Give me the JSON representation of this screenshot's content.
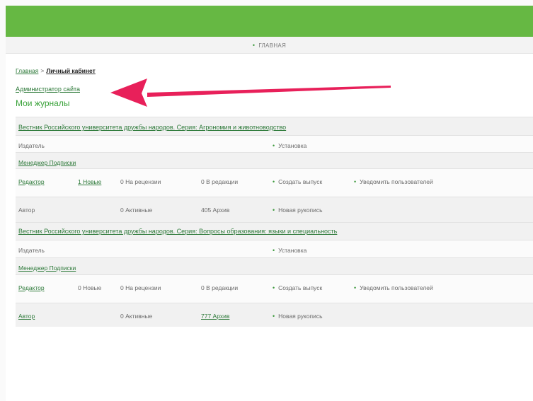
{
  "menu": {
    "home": "ГЛАВНАЯ"
  },
  "breadcrumb": {
    "home": "Главная",
    "separator": ">",
    "current": "Личный кабинет"
  },
  "role_link": "Администратор сайта",
  "page_title": "Мои журналы",
  "bullet": "•",
  "annotation_color": "#e8205a",
  "journals": [
    {
      "title": "Вестник Российского университета дружбы народов. Серия: Агрономия и животноводство",
      "publisher": {
        "label": "Издатель",
        "action": "Установка"
      },
      "subscription_manager": "Менеджер Подписки",
      "editor": {
        "label": "Редактор",
        "new": "1 Новые",
        "review": "0 На рецензии",
        "editing": "0 В редакции",
        "action1": "Создать выпуск",
        "action2": "Уведомить пользователей"
      },
      "author": {
        "label": "Автор",
        "active": "0 Активные",
        "archive": "405 Архив",
        "action": "Новая рукопись"
      }
    },
    {
      "title": "Вестник Российского университета дружбы народов. Серия: Вопросы образования: языки и специальность",
      "publisher": {
        "label": "Издатель",
        "action": "Установка"
      },
      "subscription_manager": "Менеджер Подписки",
      "editor": {
        "label": "Редактор",
        "new": "0 Новые",
        "review": "0 На рецензии",
        "editing": "0 В редакции",
        "action1": "Создать выпуск",
        "action2": "Уведомить пользователей"
      },
      "author": {
        "label": "Автор",
        "active": "0 Активные",
        "archive": "777 Архив",
        "action": "Новая рукопись"
      }
    }
  ]
}
